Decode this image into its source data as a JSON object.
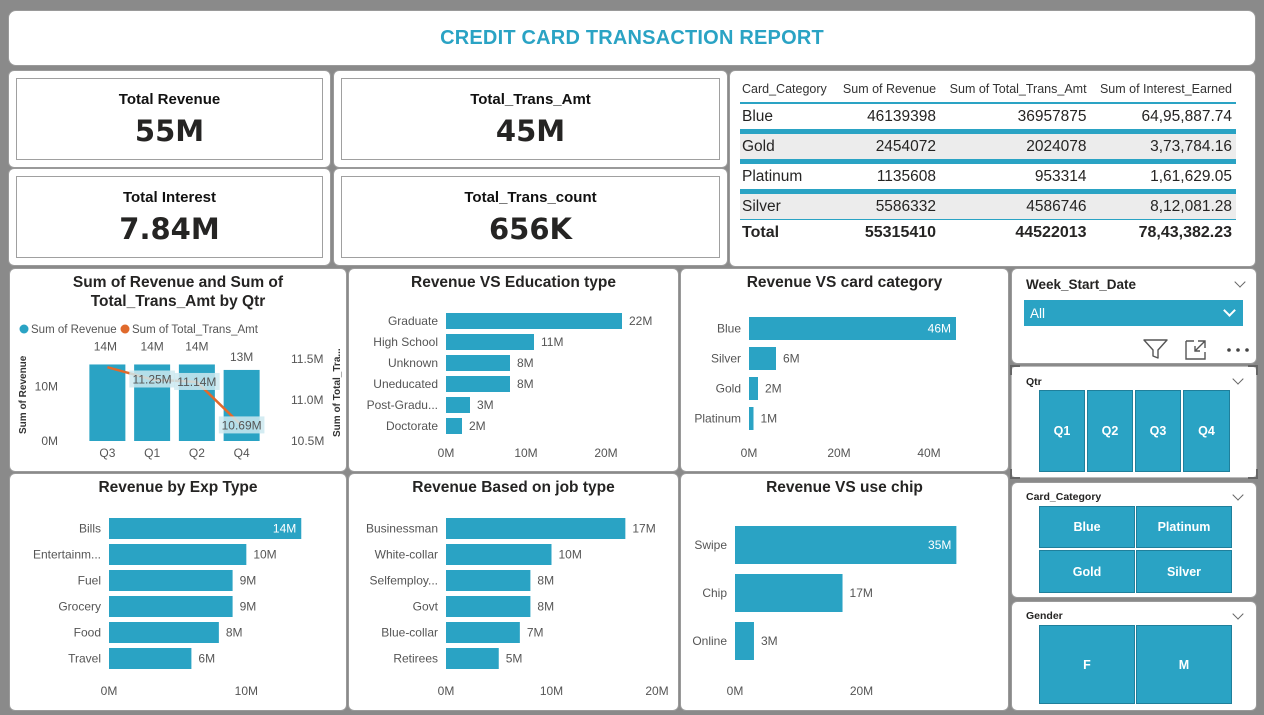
{
  "report": {
    "title": "CREDIT CARD TRANSACTION REPORT"
  },
  "kpis": {
    "total_revenue": {
      "label": "Total Revenue",
      "value": "55M"
    },
    "total_trans_amt": {
      "label": "Total_Trans_Amt",
      "value": "45M"
    },
    "total_interest": {
      "label": "Total Interest",
      "value": "7.84M"
    },
    "total_trans_count": {
      "label": "Total_Trans_count",
      "value": "656K"
    }
  },
  "matrix": {
    "headers": [
      "Card_Category",
      "Sum of Revenue",
      "Sum of Total_Trans_Amt",
      "Sum of Interest_Earned"
    ],
    "rows": [
      [
        "Blue",
        "46139398",
        "36957875",
        "64,95,887.74"
      ],
      [
        "Gold",
        "2454072",
        "2024078",
        "3,73,784.16"
      ],
      [
        "Platinum",
        "1135608",
        "953314",
        "1,61,629.05"
      ],
      [
        "Silver",
        "5586332",
        "4586746",
        "8,12,081.28"
      ]
    ],
    "total": [
      "Total",
      "55315410",
      "44522013",
      "78,43,382.23"
    ]
  },
  "colors": {
    "accent": "#2aa3c4",
    "line": "#e06a2c",
    "bar": "#2aa3c4"
  },
  "chart_data": [
    {
      "type": "bar+line",
      "title": "Sum of Revenue and Sum of Total_Trans_Amt by Qtr",
      "ylabel": "Sum of Revenue",
      "y2label": "Sum of Total_Tra...",
      "categories": [
        "Q3",
        "Q1",
        "Q2",
        "Q4"
      ],
      "series": [
        {
          "name": "Sum of Revenue",
          "values": [
            14,
            14,
            14,
            13
          ],
          "labels": [
            "14M",
            "14M",
            "14M",
            "13M"
          ]
        },
        {
          "name": "Sum of Total_Trans_Amt",
          "values": [
            11.4,
            11.25,
            11.22,
            10.69
          ],
          "labels": [
            "",
            "11.25M",
            "11.14M",
            "10.69M"
          ]
        }
      ],
      "yticks": [
        "0M",
        "10M"
      ],
      "y2ticks": [
        "11.5M",
        "11.0M",
        "10.5M"
      ],
      "ylim": [
        0,
        15
      ],
      "y2lim": [
        10.5,
        11.5
      ]
    },
    {
      "type": "bar",
      "title": "Revenue VS Education type",
      "categories": [
        "Graduate",
        "High School",
        "Unknown",
        "Uneducated",
        "Post-Gradu...",
        "Doctorate"
      ],
      "values": [
        22,
        11,
        8,
        8,
        3,
        2
      ],
      "labels": [
        "22M",
        "11M",
        "8M",
        "8M",
        "3M",
        "2M"
      ],
      "xticks": [
        "0M",
        "10M",
        "20M"
      ],
      "xlim": [
        0,
        26
      ]
    },
    {
      "type": "bar",
      "title": "Revenue VS card category",
      "categories": [
        "Blue",
        "Silver",
        "Gold",
        "Platinum"
      ],
      "values": [
        46,
        6,
        2,
        1
      ],
      "labels": [
        "46M",
        "6M",
        "2M",
        "1M"
      ],
      "xticks": [
        "0M",
        "20M",
        "40M"
      ],
      "xlim": [
        0,
        50
      ]
    },
    {
      "type": "bar",
      "title": "Revenue by Exp Type",
      "categories": [
        "Bills",
        "Entertainm...",
        "Fuel",
        "Grocery",
        "Food",
        "Travel"
      ],
      "values": [
        14,
        10,
        9,
        9,
        8,
        6
      ],
      "labels": [
        "14M",
        "10M",
        "9M",
        "9M",
        "8M",
        "6M"
      ],
      "xticks": [
        "0M",
        "10M"
      ],
      "xlim": [
        0,
        15
      ]
    },
    {
      "type": "bar",
      "title": "Revenue Based on job type",
      "categories": [
        "Businessman",
        "White-collar",
        "Selfemploy...",
        "Govt",
        "Blue-collar",
        "Retirees"
      ],
      "values": [
        17,
        10,
        8,
        8,
        7,
        5
      ],
      "labels": [
        "17M",
        "10M",
        "8M",
        "8M",
        "7M",
        "5M"
      ],
      "xticks": [
        "0M",
        "10M",
        "20M"
      ],
      "xlim": [
        0,
        20
      ]
    },
    {
      "type": "bar",
      "title": "Revenue VS use chip",
      "categories": [
        "Swipe",
        "Chip",
        "Online"
      ],
      "values": [
        35,
        17,
        3
      ],
      "labels": [
        "35M",
        "17M",
        "3M"
      ],
      "xticks": [
        "0M",
        "20M"
      ],
      "xlim": [
        0,
        40
      ]
    }
  ],
  "slicers": {
    "week": {
      "title": "Week_Start_Date",
      "selected": "All"
    },
    "qtr": {
      "title": "Qtr",
      "options": [
        "Q1",
        "Q2",
        "Q3",
        "Q4"
      ]
    },
    "card": {
      "title": "Card_Category",
      "options": [
        "Blue",
        "Platinum",
        "Gold",
        "Silver"
      ]
    },
    "gender": {
      "title": "Gender",
      "options": [
        "F",
        "M"
      ]
    }
  },
  "icons": [
    "filter-icon",
    "focus-mode-icon",
    "more-options-icon",
    "chevron-down-icon"
  ]
}
